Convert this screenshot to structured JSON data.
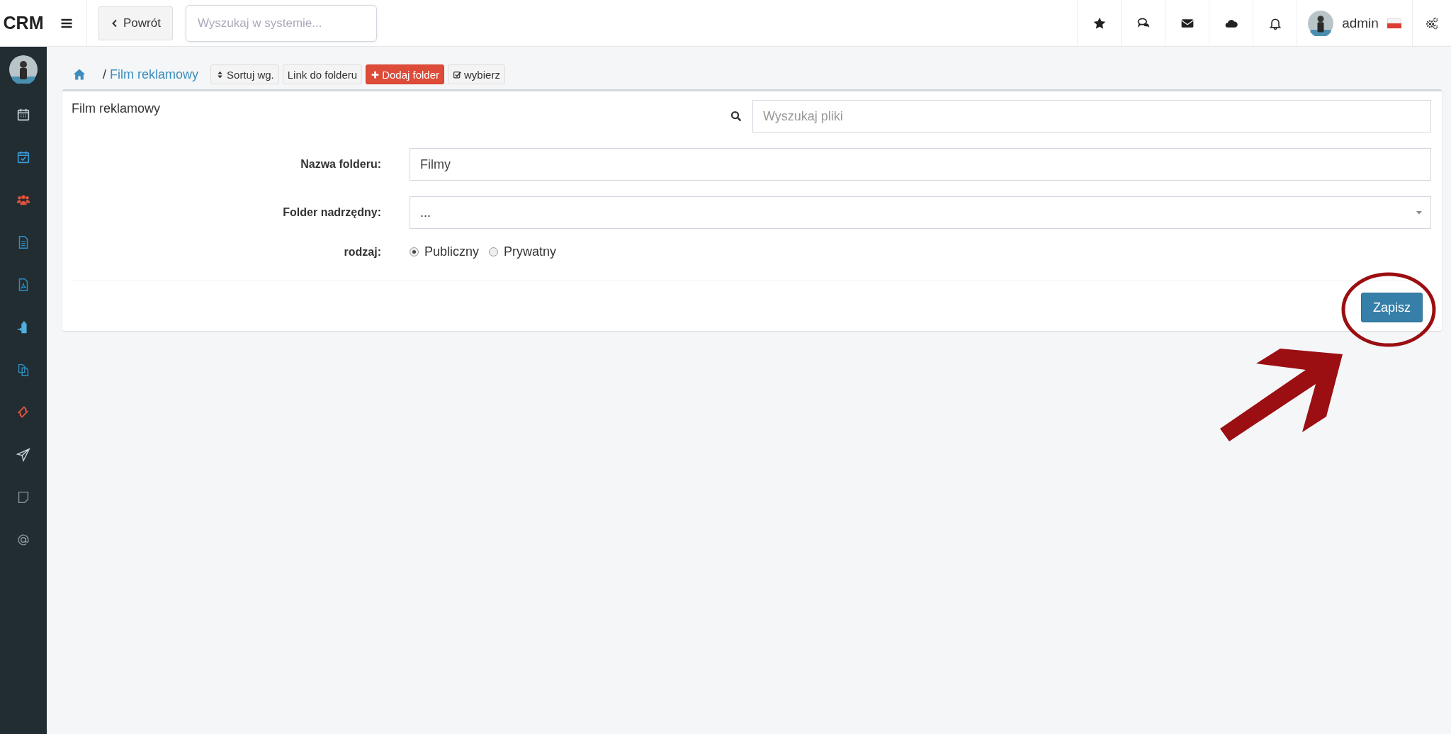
{
  "topbar": {
    "logo": "CRM",
    "back_button": "Powrót",
    "search": {
      "placeholder": "Wyszukaj w systemie..."
    },
    "user": {
      "name": "admin"
    }
  },
  "sidebar": {
    "items": [
      {
        "color": "#c9d1d6"
      },
      {
        "color": "#3c9ad6"
      },
      {
        "color": "#e0533f"
      },
      {
        "color": "#2d8fc4"
      },
      {
        "color": "#2d8fc4"
      },
      {
        "color": "#4fb0e0"
      },
      {
        "color": "#2d8fc4"
      },
      {
        "color": "#e0533f"
      },
      {
        "color": "#c9d1d6"
      },
      {
        "color": "#8a949a"
      },
      {
        "color": "#8a949a"
      }
    ]
  },
  "breadcrumb": {
    "separator": "/",
    "current": "Film reklamowy"
  },
  "toolbar": [
    {
      "label": "Sortuj wg.",
      "kind": "sort"
    },
    {
      "label": "Link do folderu",
      "kind": "plain"
    },
    {
      "label": "Dodaj folder",
      "kind": "add"
    },
    {
      "label": "wybierz",
      "kind": "check"
    }
  ],
  "card": {
    "title": "Film reklamowy",
    "search": {
      "placeholder": "Wyszukaj pliki"
    },
    "fields": [
      {
        "kind": "text",
        "label": "Nazwa folderu:",
        "value": "Filmy"
      },
      {
        "kind": "select",
        "label": "Folder nadrzędny:",
        "value": "..."
      },
      {
        "kind": "radio",
        "label": "rodzaj:",
        "options": [
          {
            "label": "Publiczny",
            "selected": true
          },
          {
            "label": "Prywatny",
            "selected": false
          }
        ]
      }
    ],
    "save_button": "Zapisz"
  }
}
